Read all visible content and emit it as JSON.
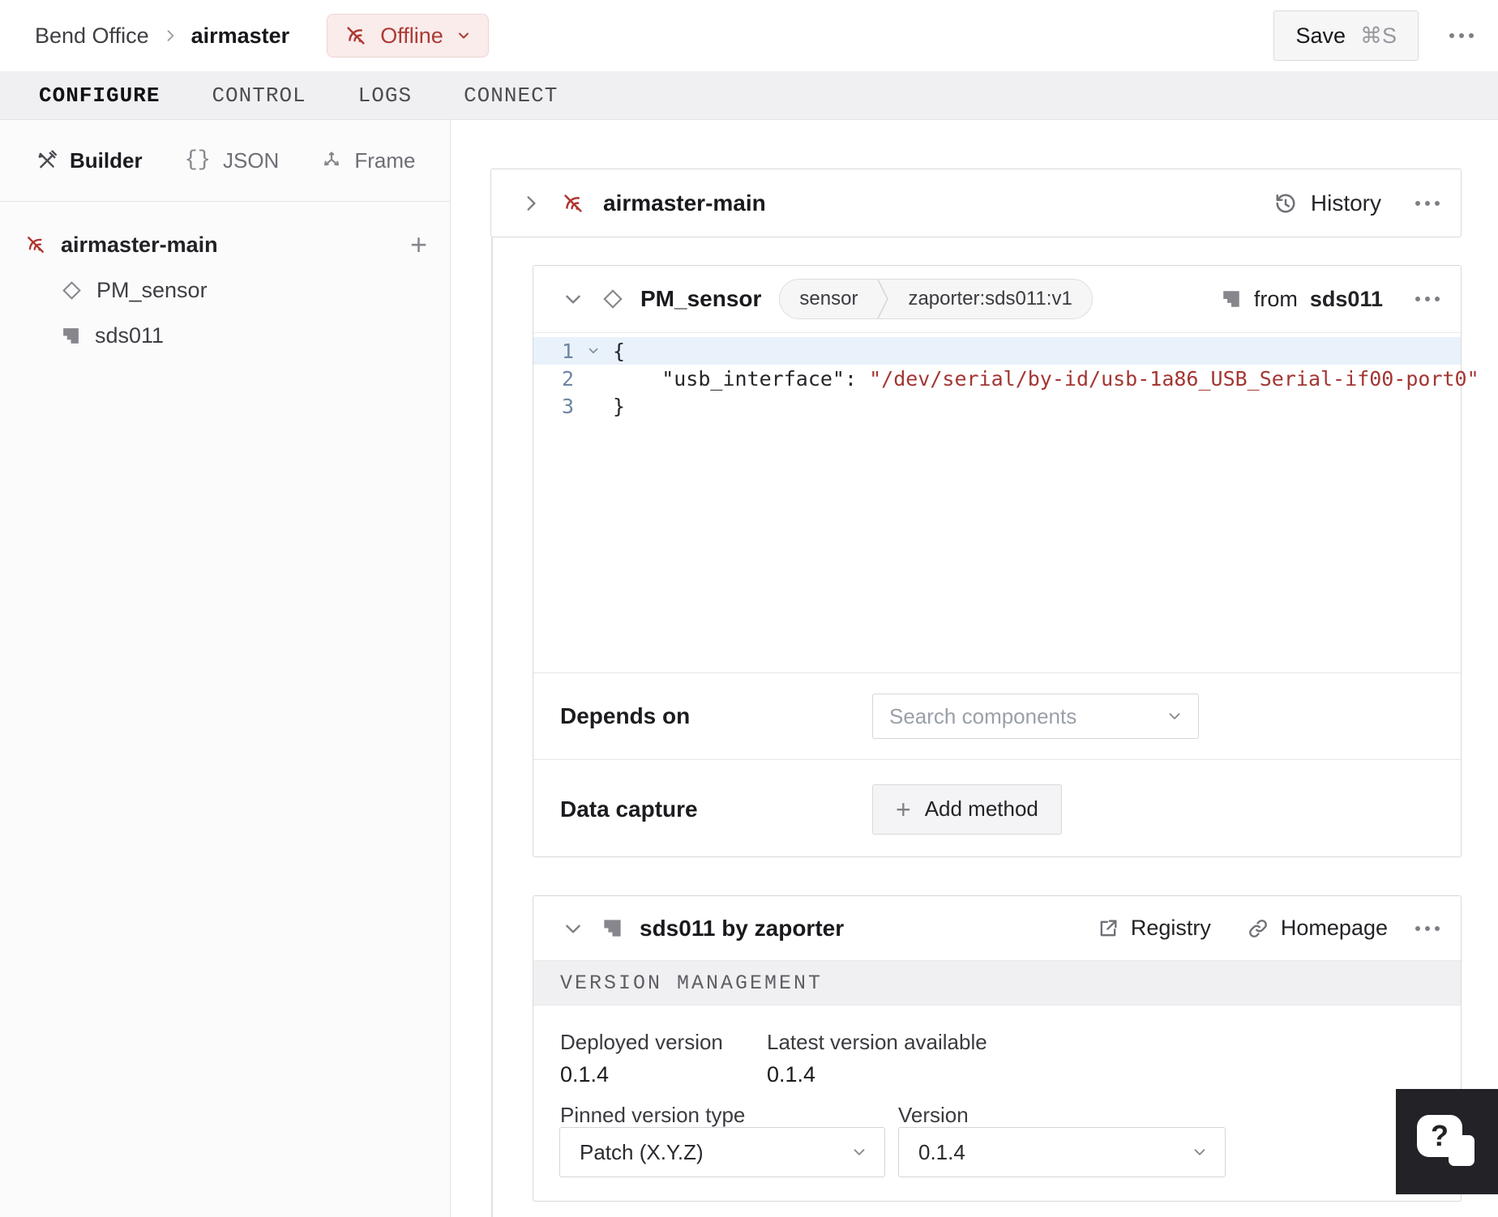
{
  "header": {
    "breadcrumb": {
      "location": "Bend Office",
      "machine": "airmaster"
    },
    "status_badge": {
      "label": "Offline"
    },
    "save_button": {
      "label": "Save",
      "shortcut": "⌘S"
    }
  },
  "tabs": [
    {
      "label": "CONFIGURE",
      "active": true
    },
    {
      "label": "CONTROL",
      "active": false
    },
    {
      "label": "LOGS",
      "active": false
    },
    {
      "label": "CONNECT",
      "active": false
    }
  ],
  "sidebar": {
    "modes": [
      {
        "label": "Builder",
        "active": true
      },
      {
        "label": "JSON",
        "active": false
      },
      {
        "label": "Frame",
        "active": false
      }
    ],
    "tree": {
      "part": "airmaster-main",
      "children": [
        {
          "label": "PM_sensor",
          "icon": "diamond-icon"
        },
        {
          "label": "sds011",
          "icon": "module-icon"
        }
      ]
    }
  },
  "main": {
    "part_card": {
      "title": "airmaster-main",
      "history_label": "History"
    },
    "sensor_card": {
      "title": "PM_sensor",
      "type_badge": "sensor",
      "model_badge": "zaporter:sds011:v1",
      "from_prefix": "from",
      "from_module": "sds011",
      "code": {
        "lines": [
          {
            "num": "1",
            "segments": [
              {
                "text": "{",
                "type": "plain"
              }
            ]
          },
          {
            "num": "2",
            "segments": [
              {
                "text": "    \"usb_interface\"",
                "type": "plain"
              },
              {
                "text": ": ",
                "type": "plain"
              },
              {
                "text": "\"/dev/serial/by-id/usb-1a86_USB_Serial-if00-port0\"",
                "type": "string"
              }
            ]
          },
          {
            "num": "3",
            "segments": [
              {
                "text": "}",
                "type": "plain"
              }
            ]
          }
        ]
      },
      "depends_on": {
        "label": "Depends on",
        "placeholder": "Search components"
      },
      "data_capture": {
        "label": "Data capture",
        "button_label": "Add method"
      }
    },
    "module_card": {
      "title": "sds011 by zaporter",
      "registry_label": "Registry",
      "homepage_label": "Homepage",
      "section_title": "VERSION MANAGEMENT",
      "deployed": {
        "label": "Deployed version",
        "value": "0.1.4"
      },
      "latest": {
        "label": "Latest version available",
        "value": "0.1.4"
      },
      "pinned_type": {
        "label": "Pinned version type",
        "value": "Patch (X.Y.Z)"
      },
      "version": {
        "label": "Version",
        "value": "0.1.4"
      }
    }
  },
  "icons": {
    "plus": "+",
    "question": "?"
  },
  "colors": {
    "offline_red": "#ac3a35",
    "offline_bg": "#f9eceb",
    "code_string": "#a33632",
    "line_number": "#6d86a3",
    "active_line_bg": "#e9f1fa",
    "card_border": "#d9d9dc",
    "tabbar_bg": "#f0f0f2"
  }
}
